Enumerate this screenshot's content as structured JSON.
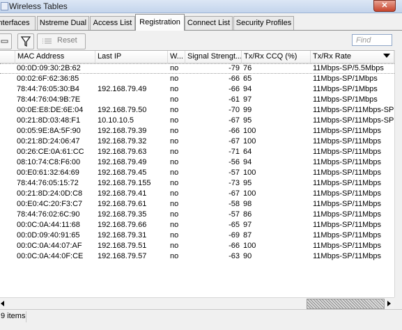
{
  "window": {
    "title": "Wireless Tables",
    "close_glyph": "✕"
  },
  "tabs": [
    {
      "label": "Interfaces"
    },
    {
      "label": "Nstreme Dual"
    },
    {
      "label": "Access List"
    },
    {
      "label": "Registration"
    },
    {
      "label": "Connect List"
    },
    {
      "label": "Security Profiles"
    }
  ],
  "toolbar": {
    "reset_label": "Reset",
    "find_placeholder": "Find"
  },
  "table": {
    "columns": [
      "MAC Address",
      "Last IP",
      "W...",
      "Signal Strengt...",
      "Tx/Rx CCQ (%)",
      "Tx/Rx Rate"
    ],
    "rows": [
      {
        "mac": "00:0D:09:30:2B:62",
        "ip": "",
        "w": "no",
        "signal": "-79",
        "ccq": "76",
        "rate": "11Mbps-SP/5.5Mbps"
      },
      {
        "mac": "00:02:6F:62:36:85",
        "ip": "",
        "w": "no",
        "signal": "-66",
        "ccq": "65",
        "rate": "11Mbps-SP/1Mbps"
      },
      {
        "mac": "78:44:76:05:30:B4",
        "ip": "192.168.79.49",
        "w": "no",
        "signal": "-66",
        "ccq": "94",
        "rate": "11Mbps-SP/1Mbps"
      },
      {
        "mac": "78:44:76:04:9B:7E",
        "ip": "",
        "w": "no",
        "signal": "-61",
        "ccq": "97",
        "rate": "11Mbps-SP/1Mbps"
      },
      {
        "mac": "00:0E:E8:DE:6E:04",
        "ip": "192.168.79.50",
        "w": "no",
        "signal": "-70",
        "ccq": "99",
        "rate": "11Mbps-SP/11Mbps-SP"
      },
      {
        "mac": "00:21:8D:03:48:F1",
        "ip": "10.10.10.5",
        "w": "no",
        "signal": "-67",
        "ccq": "95",
        "rate": "11Mbps-SP/11Mbps-SP"
      },
      {
        "mac": "00:05:9E:8A:5F:90",
        "ip": "192.168.79.39",
        "w": "no",
        "signal": "-66",
        "ccq": "100",
        "rate": "11Mbps-SP/11Mbps"
      },
      {
        "mac": "00:21:8D:24:06:47",
        "ip": "192.168.79.32",
        "w": "no",
        "signal": "-67",
        "ccq": "100",
        "rate": "11Mbps-SP/11Mbps"
      },
      {
        "mac": "00:26:CE:0A:61:CC",
        "ip": "192.168.79.63",
        "w": "no",
        "signal": "-71",
        "ccq": "64",
        "rate": "11Mbps-SP/11Mbps"
      },
      {
        "mac": "08:10:74:C8:F6:00",
        "ip": "192.168.79.49",
        "w": "no",
        "signal": "-56",
        "ccq": "94",
        "rate": "11Mbps-SP/11Mbps"
      },
      {
        "mac": "00:E0:61:32:64:69",
        "ip": "192.168.79.45",
        "w": "no",
        "signal": "-57",
        "ccq": "100",
        "rate": "11Mbps-SP/11Mbps"
      },
      {
        "mac": "78:44:76:05:15:72",
        "ip": "192.168.79.155",
        "w": "no",
        "signal": "-73",
        "ccq": "95",
        "rate": "11Mbps-SP/11Mbps"
      },
      {
        "mac": "00:21:8D:24:0D:C8",
        "ip": "192.168.79.41",
        "w": "no",
        "signal": "-67",
        "ccq": "100",
        "rate": "11Mbps-SP/11Mbps"
      },
      {
        "mac": "00:E0:4C:20:F3:C7",
        "ip": "192.168.79.61",
        "w": "no",
        "signal": "-58",
        "ccq": "98",
        "rate": "11Mbps-SP/11Mbps"
      },
      {
        "mac": "78:44:76:02:6C:90",
        "ip": "192.168.79.35",
        "w": "no",
        "signal": "-57",
        "ccq": "86",
        "rate": "11Mbps-SP/11Mbps"
      },
      {
        "mac": "00:0C:0A:44:11:68",
        "ip": "192.168.79.66",
        "w": "no",
        "signal": "-65",
        "ccq": "97",
        "rate": "11Mbps-SP/11Mbps"
      },
      {
        "mac": "00:0D:09:40:91:65",
        "ip": "192.168.79.31",
        "w": "no",
        "signal": "-69",
        "ccq": "87",
        "rate": "11Mbps-SP/11Mbps"
      },
      {
        "mac": "00:0C:0A:44:07:AF",
        "ip": "192.168.79.51",
        "w": "no",
        "signal": "-66",
        "ccq": "100",
        "rate": "11Mbps-SP/11Mbps"
      },
      {
        "mac": "00:0C:0A:44:0F:CE",
        "ip": "192.168.79.57",
        "w": "no",
        "signal": "-63",
        "ccq": "90",
        "rate": "11Mbps-SP/11Mbps"
      }
    ]
  },
  "status": {
    "count_text": "9 items"
  }
}
